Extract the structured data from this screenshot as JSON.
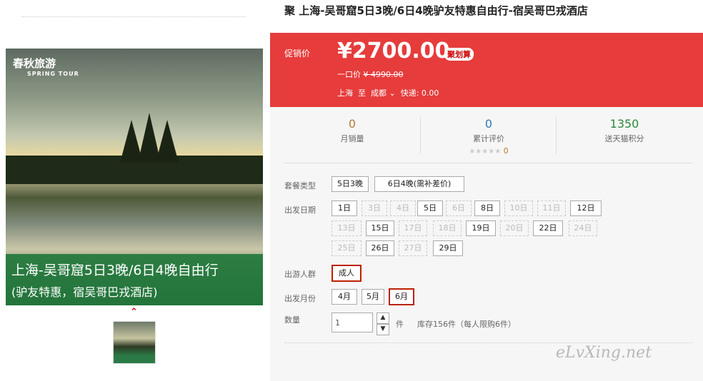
{
  "product": {
    "title": "聚 上海-吴哥窟5日3晚/6日4晚驴友特惠自由行-宿吴哥巴戎酒店",
    "image": {
      "logo_cn": "春秋旅游",
      "logo_en": "SPRING TOUR",
      "caption_line1": "上海-吴哥窟5日3晚/6日4晚自由行",
      "caption_line2": "(驴友特惠，宿吴哥巴戎酒店)"
    }
  },
  "promo": {
    "label": "促销价",
    "price": "¥2700.00",
    "badge": "聚划算",
    "orig_label": "一口价",
    "orig_price": "¥ 4990.00",
    "from": "上海",
    "to_word": "至",
    "dest": "成都",
    "shipping": "快递: 0.00"
  },
  "stats": [
    {
      "value": "0",
      "label": "月销量",
      "color": "#b97a33"
    },
    {
      "value": "0",
      "label": "累计评价",
      "color": "#3478b7",
      "stars": "★★★★★",
      "rating": "0"
    },
    {
      "value": "1350",
      "label": "送天猫积分",
      "color": "#2b8a3e"
    }
  ],
  "package": {
    "label": "套餐类型",
    "options": [
      "5日3晚",
      "6日4晚(需补差价)"
    ]
  },
  "dates": {
    "label": "出发日期",
    "days": [
      "1日",
      "3日",
      "4日",
      "5日",
      "6日",
      "8日",
      "10日",
      "11日",
      "12日",
      "13日",
      "15日",
      "17日",
      "18日",
      "19日",
      "20日",
      "22日",
      "24日",
      "25日",
      "26日",
      "27日",
      "29日"
    ]
  },
  "people": {
    "label": "出游人群",
    "option": "成人"
  },
  "months": {
    "label": "出发月份",
    "options": [
      "4月",
      "5月",
      "6月"
    ]
  },
  "quantity": {
    "label": "数量",
    "value": "1",
    "unit": "件",
    "stock": "库存156件（每人限购6件）"
  },
  "watermark": "eLvXing.net"
}
